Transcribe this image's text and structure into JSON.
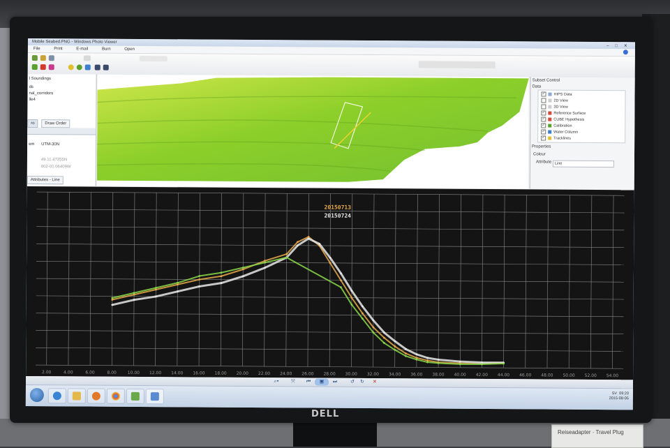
{
  "window": {
    "title": "Mobile Seabed.PNG - Windows Photo Viewer"
  },
  "menu": {
    "items": [
      "File",
      "Print",
      "E-mail",
      "Burn",
      "Open"
    ]
  },
  "left_panel": {
    "rows": [
      "l Soundings",
      "ds",
      "nal_corridors",
      "lle4"
    ],
    "tab_label": "Draw Order",
    "tab_prefix": "ro",
    "fields": [
      {
        "label": "em",
        "value": "UTM-30N"
      },
      {
        "label": "",
        "value": "49.11.47255N"
      },
      {
        "label": "",
        "value": "002-01.06409W"
      }
    ],
    "bottom_tab": "Attributes - Line"
  },
  "right_panel": {
    "title": "Subset Control",
    "data_label": "Data",
    "tree": [
      {
        "label": "HIPS Data",
        "checked": true,
        "color": "#8aa8d8"
      },
      {
        "label": "2D View",
        "checked": false,
        "color": "#cccccc"
      },
      {
        "label": "3D View",
        "checked": false,
        "color": "#cccccc"
      },
      {
        "label": "Reference Surface",
        "checked": true,
        "color": "#d24a3a"
      },
      {
        "label": "CUBE Hypothesis",
        "checked": true,
        "color": "#d24a3a"
      },
      {
        "label": "Calibration",
        "checked": true,
        "color": "#5aa02c"
      },
      {
        "label": "Water Column",
        "checked": true,
        "color": "#3a7fd0"
      },
      {
        "label": "Tracklines",
        "checked": true,
        "color": "#e0c030"
      }
    ],
    "properties_label": "Properties",
    "colour_label": "Colour",
    "attribute_label": "Attribute",
    "attribute_value": "Line"
  },
  "chart_data": {
    "type": "scatter",
    "x_ticks": [
      "2.00",
      "4.00",
      "6.00",
      "8.00",
      "10.00",
      "12.00",
      "14.00",
      "16.00",
      "18.00",
      "20.00",
      "22.00",
      "24.00",
      "26.00",
      "28.00",
      "30.00",
      "32.00",
      "34.00",
      "36.00",
      "38.00",
      "40.00",
      "42.00",
      "44.00",
      "46.00",
      "48.00",
      "50.00",
      "52.00",
      "54.00"
    ],
    "xlim": [
      1.0,
      55.0
    ],
    "ylim": [
      0,
      10
    ],
    "grid": true,
    "legend_position": "top-center",
    "series": [
      {
        "name": "20150713",
        "color": "#e6a94a",
        "x": [
          8.0,
          10.0,
          12.0,
          14.0,
          16.0,
          18.0,
          20.0,
          22.0,
          24.0,
          25.0,
          26.0,
          27.0,
          28.0,
          29.0,
          30.0,
          31.0,
          32.0,
          33.0,
          34.0,
          35.0,
          36.0,
          37.0,
          38.0,
          40.0,
          42.0,
          44.0
        ],
        "y": [
          3.8,
          4.1,
          4.4,
          4.7,
          5.0,
          5.2,
          5.6,
          6.1,
          6.5,
          7.2,
          7.5,
          7.0,
          6.0,
          5.0,
          4.0,
          3.1,
          2.3,
          1.7,
          1.2,
          0.8,
          0.55,
          0.4,
          0.3,
          0.25,
          0.25,
          0.3
        ]
      },
      {
        "name": "20150724",
        "color": "#e6e6e6",
        "x": [
          8.0,
          10.0,
          12.0,
          14.0,
          16.0,
          18.0,
          20.0,
          22.0,
          24.0,
          25.0,
          26.0,
          27.0,
          28.0,
          29.0,
          30.0,
          31.0,
          32.0,
          33.0,
          34.0,
          35.0,
          36.0,
          37.0,
          38.0,
          40.0,
          42.0,
          44.0
        ],
        "y": [
          3.5,
          3.8,
          4.0,
          4.3,
          4.6,
          4.8,
          5.2,
          5.7,
          6.3,
          7.0,
          7.4,
          7.1,
          6.3,
          5.4,
          4.4,
          3.5,
          2.7,
          2.0,
          1.5,
          1.05,
          0.75,
          0.55,
          0.45,
          0.35,
          0.3,
          0.3
        ]
      },
      {
        "name": "",
        "color": "#8ad84a",
        "x": [
          8.0,
          10.0,
          12.0,
          14.0,
          16.0,
          18.0,
          20.0,
          22.0,
          24.0,
          29.0,
          30.0,
          31.0,
          32.0,
          33.0,
          34.0,
          35.0,
          36.0,
          37.0,
          38.0,
          40.0,
          42.0,
          44.0
        ],
        "y": [
          3.9,
          4.2,
          4.5,
          4.8,
          5.2,
          5.4,
          5.7,
          6.0,
          6.3,
          4.6,
          3.6,
          2.8,
          2.0,
          1.4,
          1.0,
          0.65,
          0.45,
          0.3,
          0.25,
          0.2,
          0.2,
          0.25
        ]
      }
    ]
  },
  "viewer_controls": {
    "zoom": "⌕▾",
    "fit": "⤧",
    "prev": "⏮",
    "slideshow": "▣",
    "next": "⏭",
    "rotate_ccw": "↺",
    "rotate_cw": "↻",
    "delete": "✕"
  },
  "tray": {
    "lang": "SV",
    "time": "09:20",
    "date": "2015-08-05"
  },
  "screen_text": {
    "brand": "DELL",
    "plug_label": "Reiseadapter · Travel Plug"
  }
}
